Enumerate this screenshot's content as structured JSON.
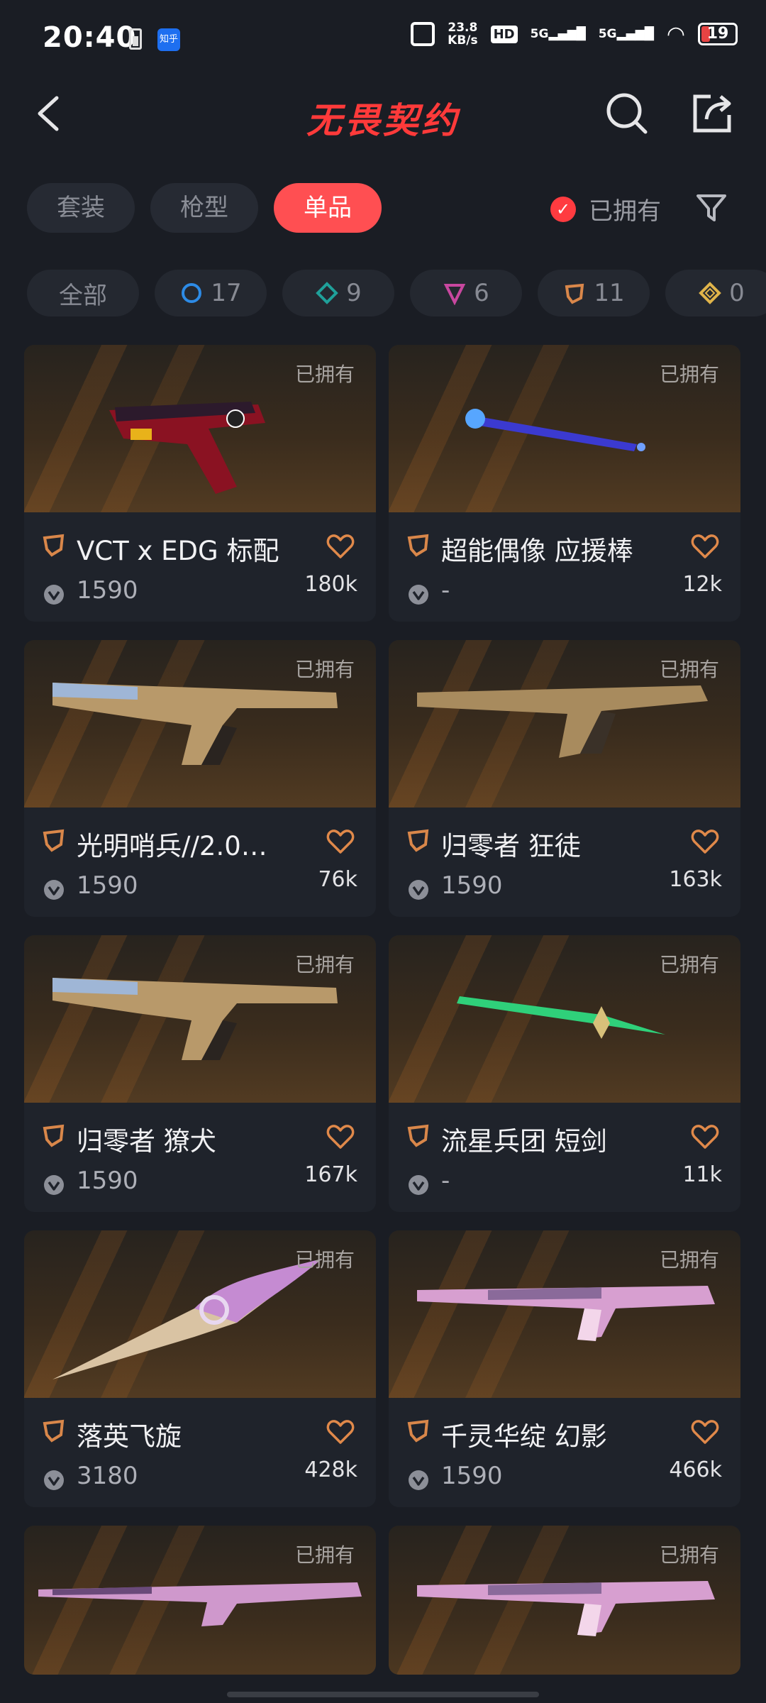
{
  "status_bar": {
    "time": "20:40",
    "app_badge": "知乎",
    "net_speed_value": "23.8",
    "net_speed_unit": "KB/s",
    "hd_label": "HD",
    "sim1": "5G",
    "sim2": "5G",
    "battery": "19"
  },
  "header": {
    "title": "无畏契约"
  },
  "tabs": [
    {
      "label": "套装",
      "active": false
    },
    {
      "label": "枪型",
      "active": false
    },
    {
      "label": "单品",
      "active": true
    }
  ],
  "owned_filter_label": "已拥有",
  "chips": [
    {
      "label": "全部",
      "icon": "all",
      "color": ""
    },
    {
      "label": "17",
      "icon": "circle-rarity-icon",
      "color": "#2d8be6"
    },
    {
      "label": "9",
      "icon": "diamond-rarity-icon",
      "color": "#1fa09a"
    },
    {
      "label": "6",
      "icon": "triangle-rarity-icon",
      "color": "#c8479f"
    },
    {
      "label": "11",
      "icon": "pentagon-rarity-icon",
      "color": "#d9874a"
    },
    {
      "label": "0",
      "icon": "rhombus-rarity-icon",
      "color": "#e0b44a"
    }
  ],
  "cards": [
    {
      "owned": "已拥有",
      "name": "VCT x EDG 标配",
      "price": "1590",
      "likes": "180k",
      "weapon": "pistol-red"
    },
    {
      "owned": "已拥有",
      "name": "超能偶像 应援棒",
      "price": "-",
      "likes": "12k",
      "weapon": "stick-blue"
    },
    {
      "owned": "已拥有",
      "name": "光明哨兵//2.0…",
      "price": "1590",
      "likes": "76k",
      "weapon": "smg-gold"
    },
    {
      "owned": "已拥有",
      "name": "归零者 狂徒",
      "price": "1590",
      "likes": "163k",
      "weapon": "rifle-gold"
    },
    {
      "owned": "已拥有",
      "name": "归零者 獠犬",
      "price": "1590",
      "likes": "167k",
      "weapon": "smg-gold"
    },
    {
      "owned": "已拥有",
      "name": "流星兵团 短剑",
      "price": "-",
      "likes": "11k",
      "weapon": "dagger-green"
    },
    {
      "owned": "已拥有",
      "name": "落英飞旋",
      "price": "3180",
      "likes": "428k",
      "weapon": "knife-pink"
    },
    {
      "owned": "已拥有",
      "name": "千灵华绽 幻影",
      "price": "1590",
      "likes": "466k",
      "weapon": "rifle-pink"
    },
    {
      "owned": "已拥有",
      "name": "",
      "price": "",
      "likes": "",
      "weapon": "sniper-pink"
    },
    {
      "owned": "已拥有",
      "name": "",
      "price": "",
      "likes": "",
      "weapon": "rifle-pink"
    }
  ]
}
